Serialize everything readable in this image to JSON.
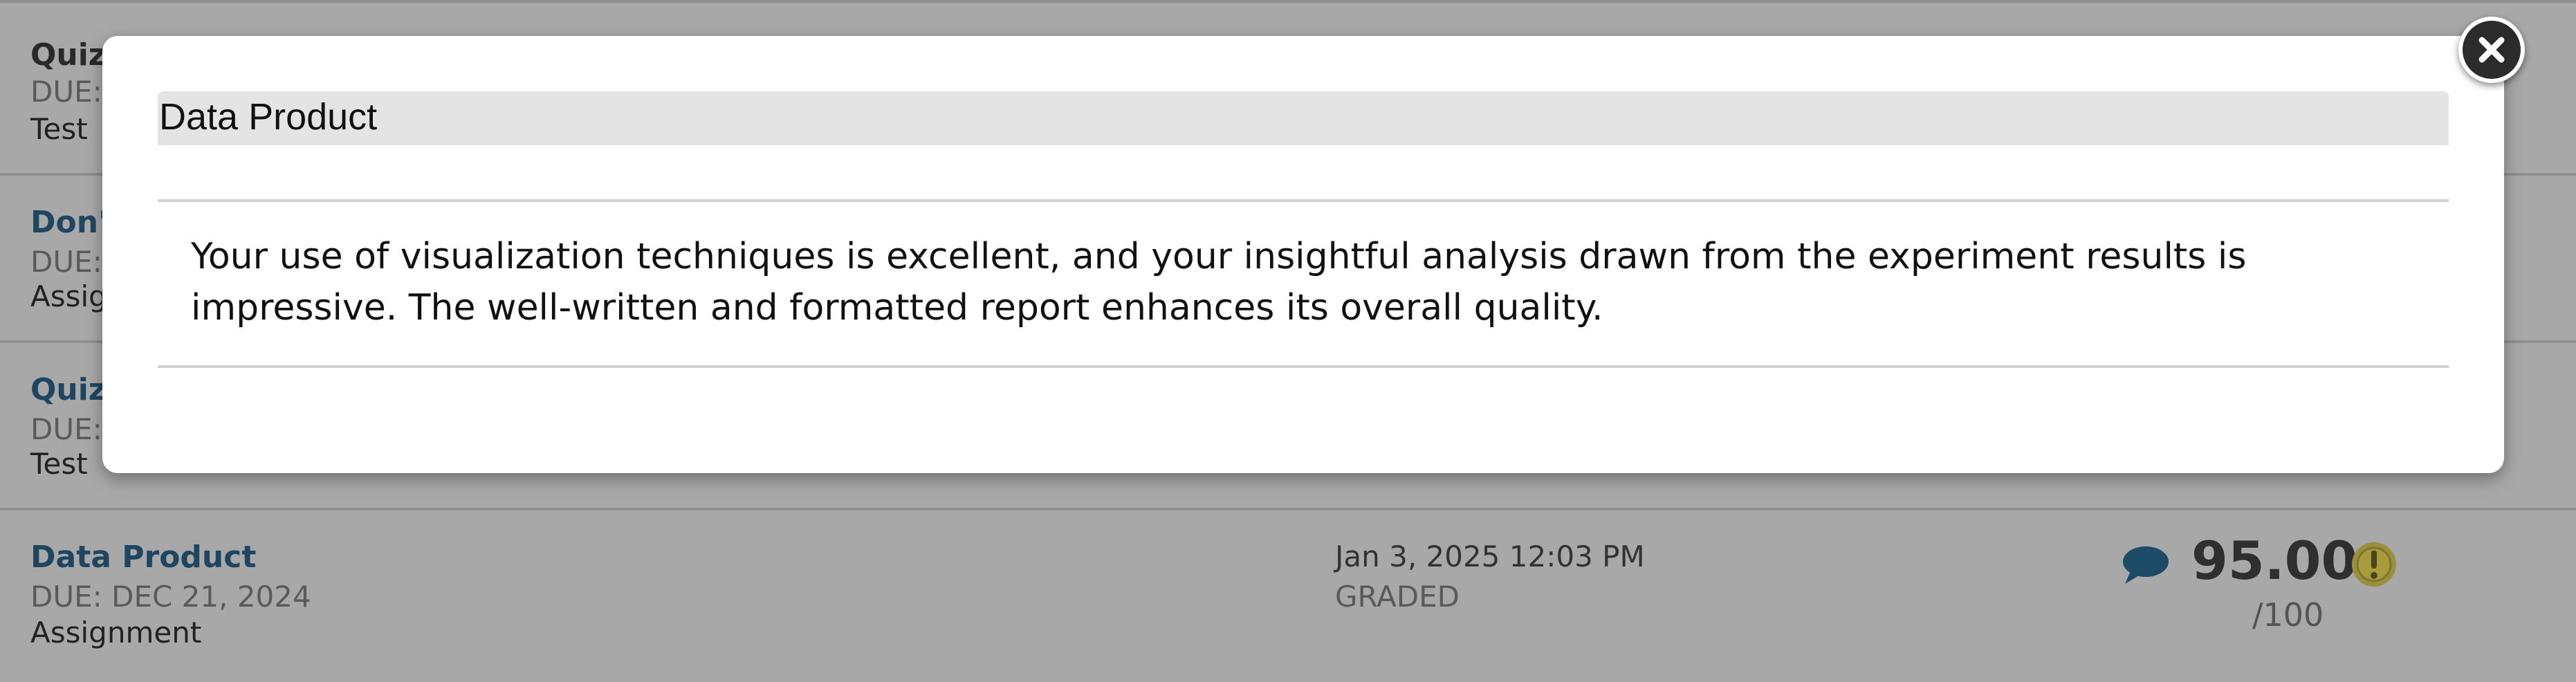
{
  "grade_list": {
    "rows": [
      {
        "title": "Quiz",
        "due": "DUE:",
        "type": "Test"
      },
      {
        "title": "Don'",
        "due": "DUE:",
        "type": "Assig"
      },
      {
        "title": "Quiz",
        "due": "DUE:",
        "type": "Test"
      },
      {
        "title": "Data Product",
        "due": "DUE: DEC 21, 2024",
        "type": "Assignment",
        "submitted": "Jan 3, 2025 12:03 PM",
        "status": "GRADED",
        "score": "95.00",
        "max_score": "/100",
        "comment_icon": "comment-bubble-icon",
        "alert_icon": "exclamation-circle-icon"
      }
    ]
  },
  "modal": {
    "title": "Data Product",
    "body": "Your use of visualization techniques is excellent, and your insightful analysis drawn from the experiment results is impressive. The well-written and formatted report enhances its overall quality.",
    "close_icon": "close-x-icon"
  },
  "colors": {
    "overlay_background": "#a8a8a8",
    "link_blue": "#1f4660",
    "header_gray": "#e4e4e4",
    "comment_blue": "#1b4b66",
    "alert_olive": "#9a8f3a"
  }
}
